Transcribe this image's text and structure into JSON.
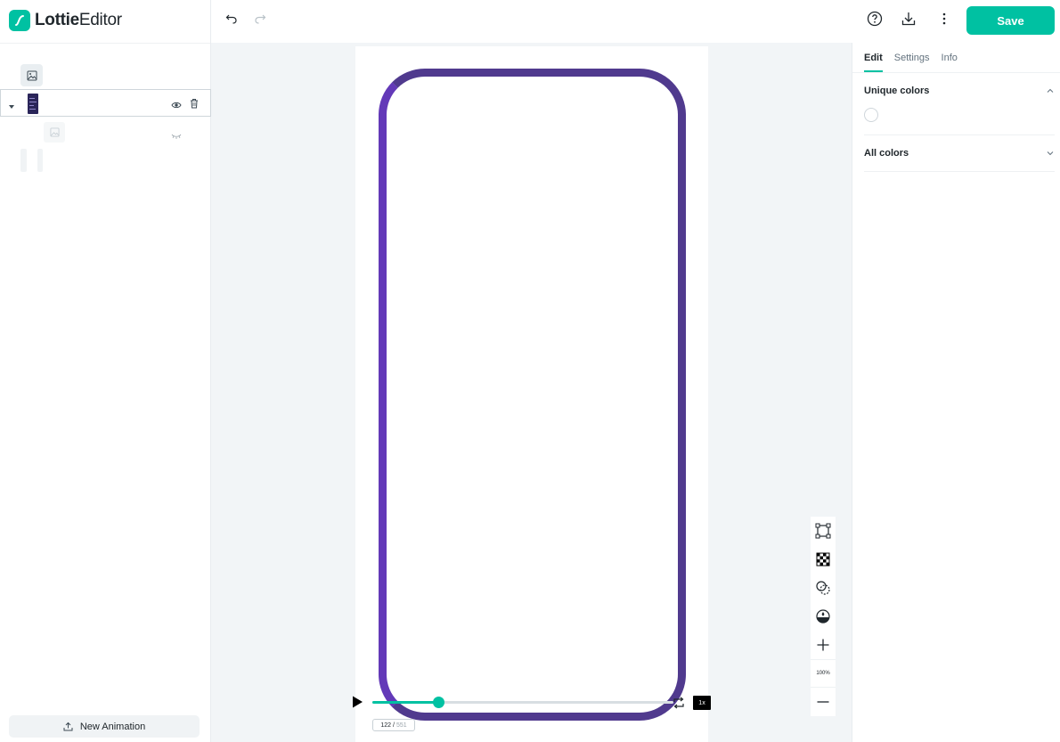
{
  "app": {
    "logo_bold": "Lottie",
    "logo_regular": "Editor"
  },
  "sidebar": {
    "new_animation_label": "New Animation"
  },
  "toolbar": {
    "save_label": "Save"
  },
  "player": {
    "current_frame": "122",
    "separator": "/",
    "total_frames": "551",
    "progress": 0.22,
    "speed": "1x"
  },
  "canvas_tools": {
    "zoom_label": "100%"
  },
  "right_panel": {
    "tabs": [
      {
        "label": "Edit",
        "active": true
      },
      {
        "label": "Settings",
        "active": false
      },
      {
        "label": "Info",
        "active": false
      }
    ],
    "unique_colors_label": "Unique colors",
    "all_colors_label": "All colors"
  },
  "colors": {
    "accent": "#00c1a2",
    "phone_frame": "#503a8e"
  },
  "icons": [
    "image-icon",
    "caret-down-icon",
    "eye-icon",
    "trash-icon",
    "eye-closed-icon",
    "upload-icon",
    "undo-icon",
    "redo-icon",
    "help-icon",
    "download-icon",
    "more-vertical-icon",
    "play-icon",
    "loop-icon",
    "bounding-box-icon",
    "checkerboard-icon",
    "overlay-icon",
    "fill-icon",
    "zoom-in-icon",
    "zoom-out-icon",
    "chevron-up-icon",
    "chevron-down-icon"
  ]
}
